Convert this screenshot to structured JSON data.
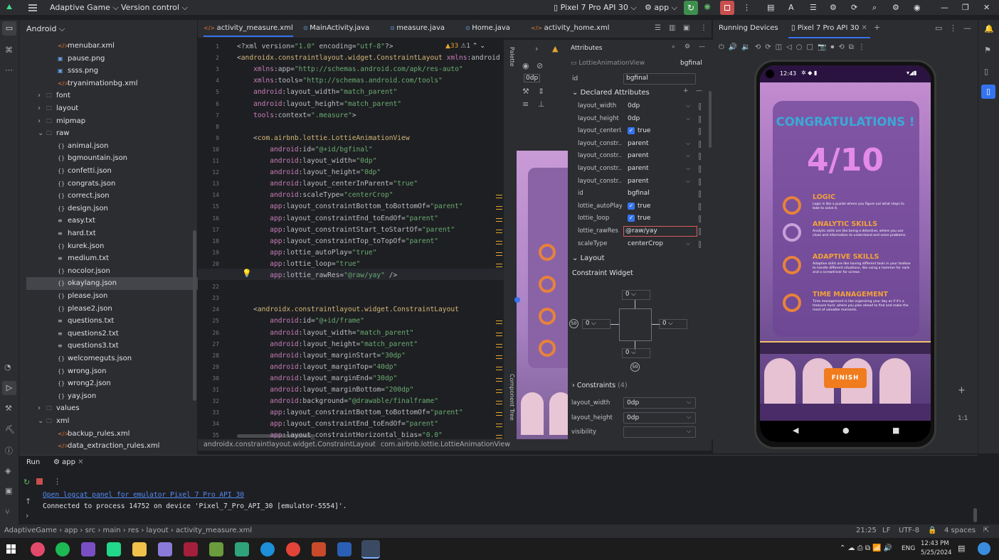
{
  "topbar": {
    "project": "Adaptive Game",
    "vcs": "Version control",
    "device": "Pixel 7 Pro API 30",
    "run_config": "app"
  },
  "project_panel": {
    "view": "Android",
    "items": [
      {
        "label": "menubar.xml",
        "icon": "xml-icon",
        "indent": 4
      },
      {
        "label": "pause.png",
        "icon": "image-icon",
        "indent": 4
      },
      {
        "label": "ssss.png",
        "icon": "image-icon",
        "indent": 4
      },
      {
        "label": "tryanimationbg.xml",
        "icon": "xml-icon",
        "indent": 4
      },
      {
        "label": "font",
        "icon": "folder-icon",
        "indent": 3,
        "arrow": "›"
      },
      {
        "label": "layout",
        "icon": "folder-icon",
        "indent": 3,
        "arrow": "›"
      },
      {
        "label": "mipmap",
        "icon": "folder-icon",
        "indent": 3,
        "arrow": "›"
      },
      {
        "label": "raw",
        "icon": "folder-icon",
        "indent": 3,
        "arrow": "⌄"
      },
      {
        "label": "animal.json",
        "icon": "json-icon",
        "indent": 4
      },
      {
        "label": "bgmountain.json",
        "icon": "json-icon",
        "indent": 4
      },
      {
        "label": "confetti.json",
        "icon": "json-icon",
        "indent": 4
      },
      {
        "label": "congrats.json",
        "icon": "json-icon",
        "indent": 4
      },
      {
        "label": "correct.json",
        "icon": "json-icon",
        "indent": 4
      },
      {
        "label": "design.json",
        "icon": "json-icon",
        "indent": 4
      },
      {
        "label": "easy.txt",
        "icon": "text-icon",
        "indent": 4
      },
      {
        "label": "hard.txt",
        "icon": "text-icon",
        "indent": 4
      },
      {
        "label": "kurek.json",
        "icon": "json-icon",
        "indent": 4
      },
      {
        "label": "medium.txt",
        "icon": "text-icon",
        "indent": 4
      },
      {
        "label": "nocolor.json",
        "icon": "json-icon",
        "indent": 4
      },
      {
        "label": "okaylang.json",
        "icon": "json-icon",
        "indent": 4,
        "selected": true
      },
      {
        "label": "please.json",
        "icon": "json-icon",
        "indent": 4
      },
      {
        "label": "please2.json",
        "icon": "json-icon",
        "indent": 4
      },
      {
        "label": "questions.txt",
        "icon": "text-icon",
        "indent": 4
      },
      {
        "label": "questions2.txt",
        "icon": "text-icon",
        "indent": 4
      },
      {
        "label": "questions3.txt",
        "icon": "text-icon",
        "indent": 4
      },
      {
        "label": "welcomeguts.json",
        "icon": "json-icon",
        "indent": 4
      },
      {
        "label": "wrong.json",
        "icon": "json-icon",
        "indent": 4
      },
      {
        "label": "wrong2.json",
        "icon": "json-icon",
        "indent": 4
      },
      {
        "label": "yay.json",
        "icon": "json-icon",
        "indent": 4
      },
      {
        "label": "values",
        "icon": "folder-icon",
        "indent": 3,
        "arrow": "›"
      },
      {
        "label": "xml",
        "icon": "folder-icon",
        "indent": 3,
        "arrow": "⌄"
      },
      {
        "label": "backup_rules.xml",
        "icon": "xml-icon",
        "indent": 4
      },
      {
        "label": "data_extraction_rules.xml",
        "icon": "xml-icon",
        "indent": 4
      }
    ]
  },
  "editor_tabs": [
    {
      "label": "activity_measure.xml",
      "active": true
    },
    {
      "label": "MainActivity.java"
    },
    {
      "label": "measure.java"
    },
    {
      "label": "Home.java"
    },
    {
      "label": "activity_home.xml"
    }
  ],
  "editor": {
    "warnings": "▲33",
    "weak": "⚠1",
    "lines": [
      {
        "n": "1",
        "t": "<?xml version=\"1.0\" encoding=\"utf-8\"?>"
      },
      {
        "n": "2",
        "t": "<androidx.constraintlayout.widget.ConstraintLayout xmlns:android"
      },
      {
        "n": "3",
        "t": "    xmlns:app=\"http://schemas.android.com/apk/res-auto\""
      },
      {
        "n": "4",
        "t": "    xmlns:tools=\"http://schemas.android.com/tools\""
      },
      {
        "n": "5",
        "t": "    android:layout_width=\"match_parent\""
      },
      {
        "n": "6",
        "t": "    android:layout_height=\"match_parent\""
      },
      {
        "n": "7",
        "t": "    tools:context=\".measure\">"
      },
      {
        "n": "8",
        "t": ""
      },
      {
        "n": "9",
        "t": "    <com.airbnb.lottie.LottieAnimationView"
      },
      {
        "n": "10",
        "t": "        android:id=\"@+id/bgfinal\""
      },
      {
        "n": "11",
        "t": "        android:layout_width=\"0dp\""
      },
      {
        "n": "12",
        "t": "        android:layout_height=\"0dp\""
      },
      {
        "n": "13",
        "t": "        android:layout_centerInParent=\"true\""
      },
      {
        "n": "14",
        "t": "        android:scaleType=\"centerCrop\""
      },
      {
        "n": "15",
        "t": "        app:layout_constraintBottom_toBottomOf=\"parent\""
      },
      {
        "n": "16",
        "t": "        app:layout_constraintEnd_toEndOf=\"parent\""
      },
      {
        "n": "17",
        "t": "        app:layout_constraintStart_toStartOf=\"parent\""
      },
      {
        "n": "18",
        "t": "        app:layout_constraintTop_toTopOf=\"parent\""
      },
      {
        "n": "19",
        "t": "        app:lottie_autoPlay=\"true\""
      },
      {
        "n": "20",
        "t": "        app:lottie_loop=\"true\""
      },
      {
        "n": "21",
        "t": "        app:lottie_rawRes=\"@raw/yay\" />"
      },
      {
        "n": "22",
        "t": ""
      },
      {
        "n": "23",
        "t": ""
      },
      {
        "n": "24",
        "t": "    <androidx.constraintlayout.widget.ConstraintLayout"
      },
      {
        "n": "25",
        "t": "        android:id=\"@+id/frame\""
      },
      {
        "n": "26",
        "t": "        android:layout_width=\"match_parent\""
      },
      {
        "n": "27",
        "t": "        android:layout_height=\"match_parent\""
      },
      {
        "n": "28",
        "t": "        android:layout_marginStart=\"30dp\""
      },
      {
        "n": "29",
        "t": "        android:layout_marginTop=\"40dp\""
      },
      {
        "n": "30",
        "t": "        android:layout_marginEnd=\"30dp\""
      },
      {
        "n": "31",
        "t": "        android:layout_marginBottom=\"200dp\""
      },
      {
        "n": "32",
        "t": "        android:background=\"@drawable/finalframe\""
      },
      {
        "n": "33",
        "t": "        app:layout_constraintBottom_toBottomOf=\"parent\""
      },
      {
        "n": "34",
        "t": "        app:layout_constraintEnd_toEndOf=\"parent\""
      },
      {
        "n": "35",
        "t": "        app:layout_constraintHorizontal_bias=\"0.0\""
      }
    ]
  },
  "breadcrumb": {
    "part1": "androidx.constraintlayout.widget.ConstraintLayout",
    "part2": "com.airbnb.lottie.LottieAnimationView"
  },
  "attributes": {
    "header": "Attributes",
    "component": "LottieAnimationView",
    "component_id": "bgfinal",
    "id_label": "id",
    "id_value": "bgfinal",
    "declared_title": "Declared Attributes",
    "declared": [
      {
        "name": "layout_width",
        "value": "0dp",
        "dd": true
      },
      {
        "name": "layout_height",
        "value": "0dp",
        "dd": true
      },
      {
        "name": "layout_centerI...",
        "value": "true",
        "check": true
      },
      {
        "name": "layout_constr...",
        "value": "parent",
        "dd": true
      },
      {
        "name": "layout_constr...",
        "value": "parent",
        "dd": true
      },
      {
        "name": "layout_constr...",
        "value": "parent",
        "dd": true
      },
      {
        "name": "layout_constr...",
        "value": "parent",
        "dd": true
      },
      {
        "name": "id",
        "value": "bgfinal"
      },
      {
        "name": "lottie_autoPlay",
        "value": "true",
        "check": true
      },
      {
        "name": "lottie_loop",
        "value": "true",
        "check": true
      },
      {
        "name": "lottie_rawRes",
        "value": "@raw/yay",
        "editing": true
      },
      {
        "name": "scaleType",
        "value": "centerCrop",
        "dd": true
      }
    ],
    "layout_title": "Layout",
    "constraint_widget": "Constraint Widget",
    "margin_top": "0",
    "margin_left": "0",
    "margin_right": "0",
    "margin_bottom": "0",
    "bias_left": "50",
    "bias_bottom": "50",
    "constraints_label": "Constraints",
    "constraints_count": "(4)",
    "bottom_fields": [
      {
        "name": "layout_width",
        "value": "0dp"
      },
      {
        "name": "layout_height",
        "value": "0dp"
      },
      {
        "name": "visibility",
        "value": ""
      }
    ]
  },
  "preview": {
    "width_label": "0dp",
    "component_tree": "Component Tree",
    "palette": "Palette"
  },
  "running": {
    "title": "Running Devices",
    "tab": "Pixel 7 Pro API 30",
    "zoom": "1:1"
  },
  "phone": {
    "time": "12:43",
    "title": "CONGRATULATIONS !",
    "score": "4/10",
    "skills": [
      {
        "title": "LOGIC",
        "desc": "Logic is like a puzzle where you figure out what steps to take to solve it.",
        "color": "#e8823a"
      },
      {
        "title": "ANALYTIC SKILLS",
        "desc": "Analytic skills are like being a detective, where you use clues and information to understand and solve problems.",
        "color": "#c9a0d8"
      },
      {
        "title": "ADAPTIVE SKILLS",
        "desc": "Adaptive skills are like having different tools in your toolbox to handle different situations, like using a hammer for nails and a screwdriver for screws.",
        "color": "#e8823a"
      },
      {
        "title": "TIME MANAGEMENT",
        "desc": "Time management is like organizing your day as if it's a treasure hunt, where you plan ahead to find and make the most of valuable moments.",
        "color": "#e8823a"
      }
    ],
    "finish": "FINISH"
  },
  "run_panel": {
    "tab_run": "Run",
    "tab_app": "app",
    "link": "Open logcat panel for emulator Pixel 7 Pro API 30",
    "message": "Connected to process 14752 on device 'Pixel_7_Pro_API_30 [emulator-5554]'."
  },
  "statusbar": {
    "crumbs": [
      "AdaptiveGame",
      "app",
      "src",
      "main",
      "res",
      "layout",
      "activity_measure.xml"
    ],
    "position": "21:25",
    "line_sep": "LF",
    "encoding": "UTF-8",
    "indent": "4 spaces"
  },
  "taskbar": {
    "lang": "ENG",
    "time": "12:43 PM",
    "date": "5/25/2024"
  },
  "colors": {
    "accent": "#3574f0",
    "warning": "#e2a531",
    "finish": "#f07c1e",
    "congrats": "#3aa9d8",
    "score": "#e48ae8"
  }
}
